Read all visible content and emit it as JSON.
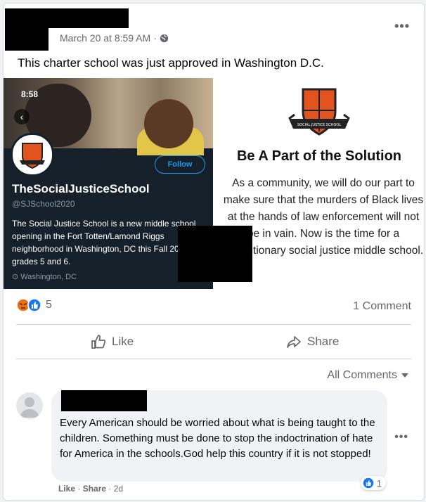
{
  "post": {
    "timestamp": "March 20 at 8:59 AM",
    "separator": "·",
    "privacy_icon": "globe-icon",
    "more_label": "•••",
    "text": "This charter school was just approved in Washington D.C."
  },
  "twitter_card": {
    "time": "8:58",
    "back_icon": "chevron-left-icon",
    "follow_label": "Follow",
    "name": "TheSocialJusticeSchool",
    "handle": "@SJSchool2020",
    "bio": "The Social Justice School is a new middle school opening in the Fort Totten/Lamond Riggs neighborhood in Washington, DC this Fall 2020 for grades 5 and 6.",
    "location": "Washington, DC"
  },
  "promo": {
    "logo_text": "SOCIAL JUSTICE SCHOOL",
    "title": "Be A Part of the Solution",
    "body": "As a community, we will do our part to make sure that the murders of Black lives at the hands of law enforcement will not be in vain. Now is the time for a revolutionary social justice middle school."
  },
  "reactions": {
    "icons": [
      "angry-icon",
      "like-icon"
    ],
    "count": "5",
    "comments": "1 Comment"
  },
  "actions": {
    "like": "Like",
    "share": "Share"
  },
  "comments_filter": "All Comments",
  "comment": {
    "text": "Every American should be worried about what is being taught to the children. Something must be done to stop the indoctrination of hate for America in the schools.God help this country if it is not stopped!",
    "like": "Like",
    "share": "Share",
    "dot": "·",
    "time": "2d",
    "reaction_count": "1",
    "more_label": "•••"
  },
  "colors": {
    "accent": "#1877f2",
    "twitter_bg": "#15202b",
    "twitter_blue": "#1d9bf0"
  }
}
